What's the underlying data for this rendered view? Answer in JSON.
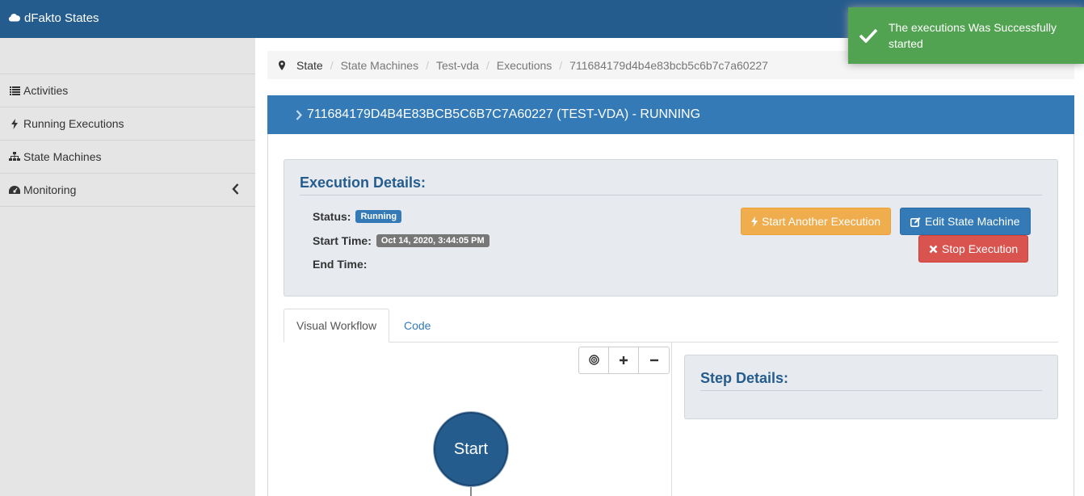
{
  "app": {
    "brand": "dFakto States"
  },
  "sidebar": {
    "items": [
      {
        "label": "Activities",
        "icon": "list-icon"
      },
      {
        "label": "Running Executions",
        "icon": "bolt-icon"
      },
      {
        "label": "State Machines",
        "icon": "sitemap-icon"
      },
      {
        "label": "Monitoring",
        "icon": "dashboard-icon"
      }
    ]
  },
  "breadcrumb": [
    "State",
    "State Machines",
    "Test-vda",
    "Executions",
    "711684179d4b4e83bcb5c6b7c7a60227"
  ],
  "panel": {
    "title": "711684179D4B4E83BCB5C6B7C7A60227 (TEST-VDA) - RUNNING"
  },
  "details": {
    "heading": "Execution Details:",
    "status_label": "Status:",
    "status_value": "Running",
    "start_label": "Start Time:",
    "start_value": "Oct 14, 2020, 3:44:05 PM",
    "end_label": "End Time:",
    "end_value": ""
  },
  "actions": {
    "start_another": "Start Another Execution",
    "edit": "Edit State Machine",
    "stop": "Stop Execution"
  },
  "tabs": [
    {
      "label": "Visual Workflow",
      "active": true
    },
    {
      "label": "Code",
      "active": false
    }
  ],
  "workflow": {
    "start_node": "Start"
  },
  "step_details": {
    "heading": "Step Details:"
  },
  "toast": {
    "message": "The executions Was Successfully started"
  },
  "colors": {
    "topbar": "#255c8e",
    "primary": "#337ab7",
    "warning": "#f0ad4e",
    "danger": "#d9534f",
    "success": "#51a351"
  }
}
